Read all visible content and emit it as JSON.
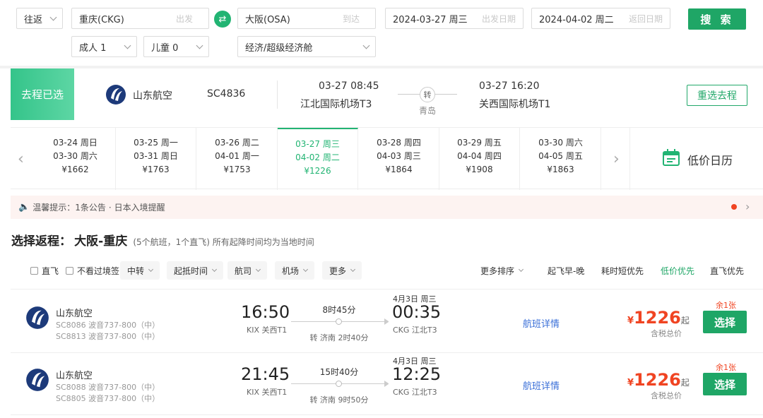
{
  "search": {
    "trip_type": "往返",
    "from_value": "重庆(CKG)",
    "from_placeholder": "出发",
    "to_value": "大阪(OSA)",
    "to_placeholder": "到达",
    "depart_date": "2024-03-27 周三",
    "depart_placeholder": "出发日期",
    "return_date": "2024-04-02 周二",
    "return_placeholder": "返回日期",
    "search_label": "搜 索",
    "adult": "成人 1",
    "child": "儿童 0",
    "cabin": "经济/超级经济舱"
  },
  "selected_outbound": {
    "tag": "去程已选",
    "airline": "山东航空",
    "flight_no": "SC4836",
    "dep_time": "03-27 08:45",
    "dep_airport": "江北国际机场T3",
    "transfer_badge": "转",
    "transfer_city": "青岛",
    "arr_time": "03-27 16:20",
    "arr_airport": "关西国际机场T1",
    "reselect_label": "重选去程"
  },
  "dates": [
    {
      "line1": "03-24 周日",
      "line2": "03-30 周六",
      "price": "¥1662",
      "active": false
    },
    {
      "line1": "03-25 周一",
      "line2": "03-31 周日",
      "price": "¥1763",
      "active": false
    },
    {
      "line1": "03-26 周二",
      "line2": "04-01 周一",
      "price": "¥1753",
      "active": false
    },
    {
      "line1": "03-27 周三",
      "line2": "04-02 周二",
      "price": "¥1226",
      "active": true
    },
    {
      "line1": "03-28 周四",
      "line2": "04-03 周三",
      "price": "¥1864",
      "active": false
    },
    {
      "line1": "03-29 周五",
      "line2": "04-04 周四",
      "price": "¥1908",
      "active": false
    },
    {
      "line1": "03-30 周六",
      "line2": "04-05 周五",
      "price": "¥1863",
      "active": false
    }
  ],
  "low_price_calendar": "低价日历",
  "notice": {
    "label": "温馨提示：",
    "count_text": "1条公告",
    "separator": "·",
    "item": "日本入境提醒"
  },
  "section": {
    "title": "选择返程：",
    "route": "大阪-重庆",
    "subtitle": "(5个航班，1个直飞) 所有起降时间均为当地时间"
  },
  "filters": {
    "direct": "直飞",
    "no_transit_visa": "不看过境签",
    "transfer": "中转",
    "time": "起抵时间",
    "airline": "航司",
    "airport": "机场",
    "more": "更多",
    "more_sort": "更多排序",
    "sort_early": "起飞早-晚",
    "sort_short": "耗时短优先",
    "sort_low": "低价优先",
    "sort_direct": "直飞优先"
  },
  "flights": [
    {
      "airline": "山东航空",
      "seg1": "SC8086 波音737-800（中）",
      "seg2": "SC8813 波音737-800（中）",
      "dep_time": "16:50",
      "dep_airport": "KIX 关西T1",
      "duration": "8时45分",
      "transfer": "转 济南 2时40分",
      "arr_date": "4月3日 周三",
      "arr_time": "00:35",
      "arr_airport": "CKG 江北T3",
      "details": "航班详情",
      "price_symbol": "¥",
      "price": "1226",
      "price_suffix": "起",
      "tax_note": "含税总价",
      "remain": "余1张",
      "select": "选择"
    },
    {
      "airline": "山东航空",
      "seg1": "SC8088 波音737-800（中）",
      "seg2": "SC8805 波音737-800（中）",
      "dep_time": "21:45",
      "dep_airport": "KIX 关西T1",
      "duration": "15时40分",
      "transfer": "转 济南 9时50分",
      "arr_date": "4月3日 周三",
      "arr_time": "12:25",
      "arr_airport": "CKG 江北T3",
      "details": "航班详情",
      "price_symbol": "¥",
      "price": "1226",
      "price_suffix": "起",
      "tax_note": "含税总价",
      "remain": "余1张",
      "select": "选择"
    }
  ],
  "colors": {
    "accent": "#1fa666",
    "price": "#f04422",
    "link": "#3a6fd8"
  }
}
